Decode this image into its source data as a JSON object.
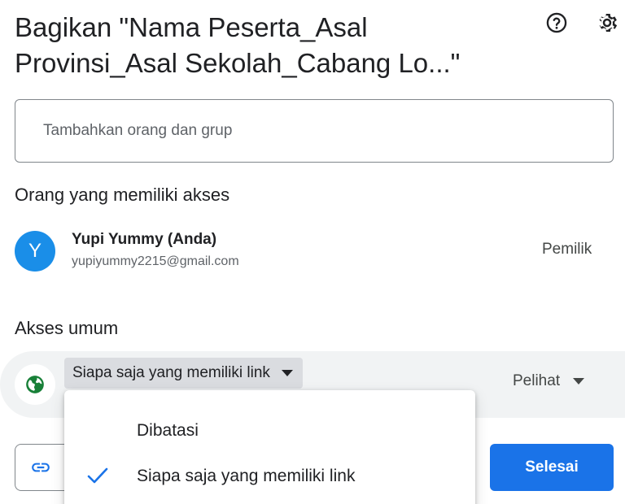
{
  "dialog": {
    "title": "Bagikan \"Nama Peserta_Asal Provinsi_Asal Sekolah_Cabang Lo...\"",
    "help_icon": "help-circle-icon",
    "settings_icon": "gear-icon"
  },
  "add_people": {
    "placeholder": "Tambahkan orang dan grup"
  },
  "people_with_access": {
    "title": "Orang yang memiliki akses",
    "people": [
      {
        "avatar_letter": "Y",
        "avatar_color": "#1a8ee8",
        "name": "Yupi Yummy (Anda)",
        "email": "yupiyummy2215@gmail.com",
        "role": "Pemilik"
      }
    ]
  },
  "general_access": {
    "title": "Akses umum",
    "selected": "Siapa saja yang memiliki link",
    "role": "Pelihat",
    "icon": "globe-icon"
  },
  "access_menu": {
    "options": [
      {
        "label": "Dibatasi",
        "selected": false
      },
      {
        "label": "Siapa saja yang memiliki link",
        "selected": true
      }
    ]
  },
  "footer": {
    "copy_link_icon": "link-icon",
    "done_label": "Selesai"
  },
  "colors": {
    "accent": "#1a73e8",
    "globe": "#188038",
    "row_background": "#f1f3f4"
  }
}
